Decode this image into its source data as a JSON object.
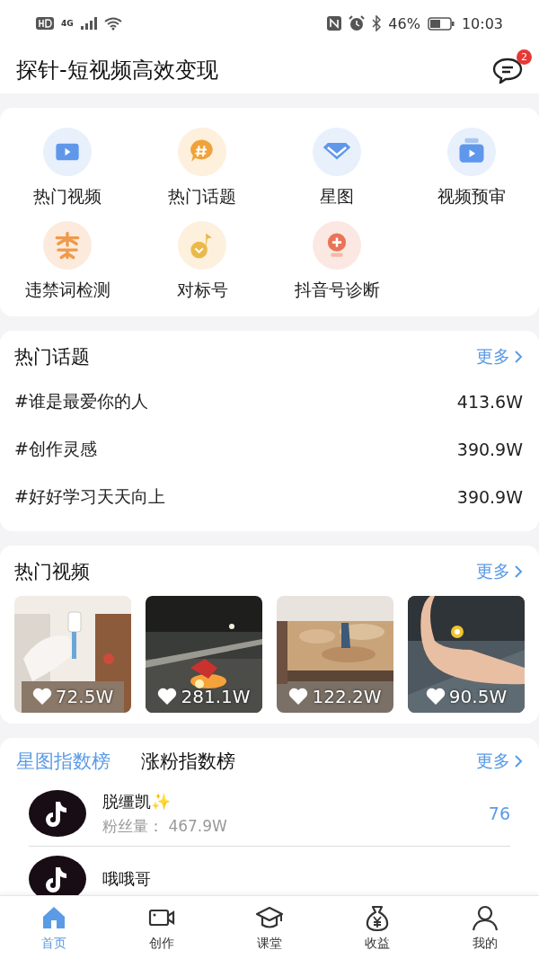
{
  "status_bar": {
    "network": "4G",
    "battery": "46%",
    "time": "10:03"
  },
  "header": {
    "title": "探针-短视频高效变现",
    "badge": "2"
  },
  "tools": [
    {
      "label": "热门视频",
      "kind": "video"
    },
    {
      "label": "热门话题",
      "kind": "topic"
    },
    {
      "label": "星图",
      "kind": "star"
    },
    {
      "label": "视频预审",
      "kind": "review"
    },
    {
      "label": "违禁词检测",
      "kind": "ban"
    },
    {
      "label": "对标号",
      "kind": "benchmark"
    },
    {
      "label": "抖音号诊断",
      "kind": "diagnose"
    }
  ],
  "hot_topics": {
    "title": "热门话题",
    "more": "更多",
    "items": [
      {
        "topic": "#谁是最爱你的人",
        "count": "413.6W"
      },
      {
        "topic": "#创作灵感",
        "count": "390.9W"
      },
      {
        "topic": "#好好学习天天向上",
        "count": "390.9W"
      }
    ]
  },
  "hot_videos": {
    "title": "热门视频",
    "more": "更多",
    "items": [
      {
        "likes": "72.5W"
      },
      {
        "likes": "281.1W"
      },
      {
        "likes": "122.2W"
      },
      {
        "likes": "90.5W"
      }
    ]
  },
  "rankings": {
    "tabs": [
      {
        "label": "星图指数榜",
        "selected": true
      },
      {
        "label": "涨粉指数榜",
        "selected": false
      }
    ],
    "more": "更多",
    "rows": [
      {
        "name": "脱缰凯✨",
        "followers": "粉丝量：  467.9W",
        "score": "76"
      },
      {
        "name": "哦哦哥"
      }
    ]
  },
  "nav": [
    {
      "label": "首页",
      "kind": "home",
      "selected": true
    },
    {
      "label": "创作",
      "kind": "camera",
      "selected": false
    },
    {
      "label": "课堂",
      "kind": "class",
      "selected": false
    },
    {
      "label": "收益",
      "kind": "money",
      "selected": false
    },
    {
      "label": "我的",
      "kind": "user",
      "selected": false
    }
  ]
}
